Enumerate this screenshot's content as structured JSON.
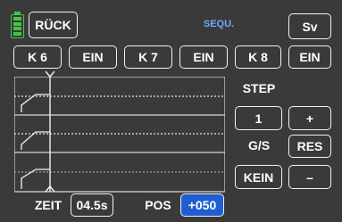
{
  "header": {
    "back_label": "RÜCK",
    "title": "SEQU.",
    "save_label": "Sv"
  },
  "channels": [
    {
      "name": "K 6",
      "state": "EIN"
    },
    {
      "name": "K 7",
      "state": "EIN"
    },
    {
      "name": "K 8",
      "state": "EIN"
    }
  ],
  "side_panel": {
    "step_label": "STEP",
    "step_value": "1",
    "plus_label": "+",
    "gs_label": "G/S",
    "reset_label": "RES",
    "gs_value": "KEIN",
    "minus_label": "–"
  },
  "footer": {
    "time_label": "ZEIT",
    "time_value": "04.5s",
    "pos_label": "POS",
    "pos_value": "+050"
  },
  "colors": {
    "background": "#3a3a3a",
    "border": "#f2f2f2",
    "title": "#6fa9ff",
    "active_field": "#1e5ed1",
    "battery": "#47c247"
  },
  "icons": [
    "battery-icon",
    "cursor-marker-icon"
  ]
}
